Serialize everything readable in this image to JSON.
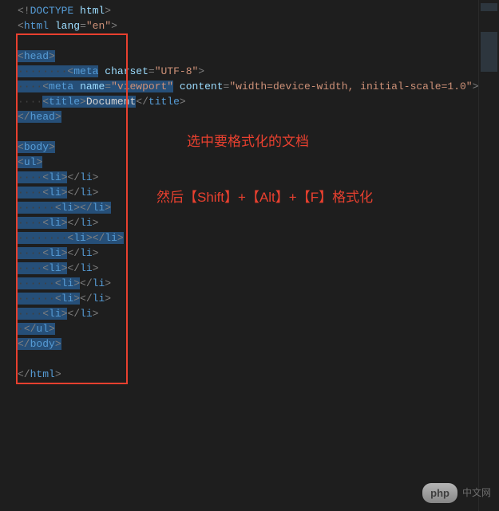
{
  "code": {
    "doctype": "<!DOCTYPE html>",
    "html_open": "html",
    "lang_attr": "lang",
    "lang_val": "\"en\"",
    "head": "head",
    "meta": "meta",
    "charset_attr": "charset",
    "charset_val": "\"UTF-8\"",
    "name_attr": "name",
    "viewport_val": "\"viewport\"",
    "content_attr": "content",
    "content_val": "\"width=device-width, initial-scale=1.0\"",
    "title": "title",
    "title_text": "Document",
    "body": "body",
    "ul": "ul",
    "li": "li"
  },
  "annotations": {
    "line1": "选中要格式化的文档",
    "line2": "然后【Shift】+【Alt】+【F】格式化"
  },
  "watermark": {
    "badge": "php",
    "text": "中文网"
  },
  "whitespace": {
    "dot": "·",
    "dots4": "····",
    "dots6": "······",
    "dots8": "········"
  }
}
